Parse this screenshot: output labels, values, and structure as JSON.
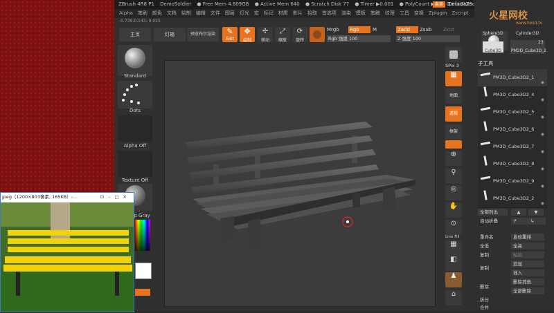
{
  "titlebar": {
    "app": "ZBrush 4R8 P1",
    "project": "DemoSoldier",
    "free_mem": "● Free Mem 4.809GB",
    "active_mem": "● Active Mem 640",
    "scratch": "● Scratch Disk 77",
    "timer": "● Timer ▶0.001",
    "poly": "● PolyCount ▶11",
    "quicksave": "QuickSave",
    "progress_label": "进程",
    "progress_val": "0",
    "menu_btn": "菜单",
    "default_script": "DefaultZScript"
  },
  "menubar": [
    "Alpha",
    "笔刷",
    "颜色",
    "文档",
    "绘制",
    "编辑",
    "文件",
    "图层",
    "灯光",
    "宏",
    "标记",
    "材质",
    "影片",
    "拾取",
    "首选项",
    "渲染",
    "模板",
    "笔触",
    "纹理",
    "工具",
    "变换",
    "Zplugin",
    "Zscript"
  ],
  "coords": "-0.739,0.143,-0.015",
  "shelf": {
    "home": "主页",
    "lightbox": "灯箱",
    "preview": "预览布尔渲染",
    "edit": "Edit",
    "draw": "绘制",
    "move": "移动",
    "scale": "缩放",
    "rotate": "旋转",
    "mrgb": "Mrgb",
    "rgb": "Rgb",
    "m": "M",
    "rgb_strength": "Rgb 强度 100",
    "zadd": "Zadd",
    "zsub": "Zsub",
    "zcut": "Zcut",
    "z_strength": "Z 强度 100"
  },
  "lefttray": {
    "brush": "Standard",
    "stroke": "Dots",
    "alpha": "Alpha Off",
    "texture": "Texture Off",
    "material": "p Gray"
  },
  "rightshelf": {
    "spix": "SPix 3",
    "bpr": "BPR",
    "floor": "地面",
    "persp": "透视",
    "frame": "框架",
    "linefill": "Line Fill",
    "move": "移动",
    "scale": "缩放",
    "rotate": "旋转",
    "transp": "Transp"
  },
  "rpanel": {
    "tools": [
      "Sphere3D",
      "Cylinder3D",
      "Cube3D",
      "PM3D_Cube3D_2"
    ],
    "count": "23",
    "subtool_header": "子工具",
    "subtools": [
      "PM3D_Cube3D2_1",
      "PM3D_Cube3D2_4",
      "PM3D_Cube3D2_5",
      "PM3D_Cube3D2_6",
      "PM3D_Cube3D2_7",
      "PM3D_Cube3D2_8",
      "PM3D_Cube3D2_9",
      "PM3D_Cube3D2_2"
    ],
    "list_all": "全部列出",
    "auto_collapse": "自动折叠",
    "rename": "重命名",
    "auto_reorder": "自动重排",
    "all_low": "全低",
    "all_high": "全高",
    "copy": "复制",
    "paste": "粘贴",
    "append": "追加",
    "insert": "插入",
    "delete": "删除",
    "del_other": "删除其他",
    "del_all": "全部删除",
    "split": "拆分",
    "merge": "合并"
  },
  "viewer": {
    "title": "jpeg（1200×803像素, 165KB）-..."
  },
  "watermark": {
    "brand": "火星网校",
    "url": "www.hxsd.tv"
  },
  "colors": {
    "accent": "#e8731f",
    "bench": "#f2d20a"
  }
}
